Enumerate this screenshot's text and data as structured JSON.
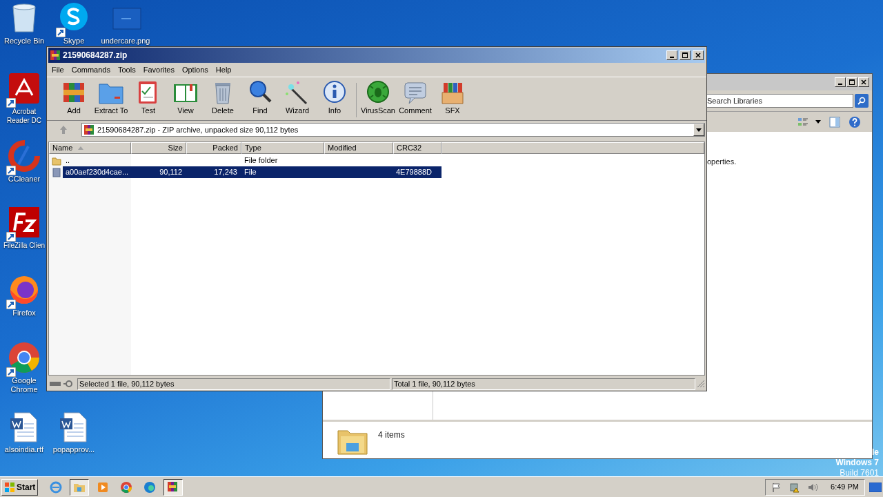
{
  "desktop_icons": [
    {
      "label": "Recycle Bin",
      "kind": "bin",
      "shortcut": false
    },
    {
      "label": "Skype",
      "kind": "skype",
      "shortcut": true
    },
    {
      "label": "undercare.png",
      "kind": "image",
      "shortcut": false
    },
    {
      "label": "Acrobat Reader DC",
      "kind": "acrobat",
      "shortcut": true
    },
    {
      "label": "CCleaner",
      "kind": "ccleaner",
      "shortcut": true
    },
    {
      "label": "FileZilla Clien",
      "kind": "filezilla",
      "shortcut": true
    },
    {
      "label": "Firefox",
      "kind": "firefox",
      "shortcut": true
    },
    {
      "label": "Google Chrome",
      "kind": "chrome",
      "shortcut": true
    },
    {
      "label": "alsoindia.rtf",
      "kind": "word",
      "shortcut": false
    },
    {
      "label": "popapprov...",
      "kind": "word",
      "shortcut": false
    }
  ],
  "explorer": {
    "search": {
      "placeholder": "Search Libraries"
    },
    "body_text": "operties.",
    "item_count": "4 items"
  },
  "winrar": {
    "title": "21590684287.zip",
    "menu": [
      "File",
      "Commands",
      "Tools",
      "Favorites",
      "Options",
      "Help"
    ],
    "toolbar": [
      {
        "label": "Add",
        "kind": "add"
      },
      {
        "label": "Extract To",
        "kind": "extract"
      },
      {
        "label": "Test",
        "kind": "test"
      },
      {
        "label": "View",
        "kind": "view"
      },
      {
        "label": "Delete",
        "kind": "delete"
      },
      {
        "label": "Find",
        "kind": "find"
      },
      {
        "label": "Wizard",
        "kind": "wizard"
      },
      {
        "label": "Info",
        "kind": "info"
      },
      {
        "label": "VirusScan",
        "kind": "virus"
      },
      {
        "label": "Comment",
        "kind": "comment"
      },
      {
        "label": "SFX",
        "kind": "sfx"
      }
    ],
    "address": "21590684287.zip - ZIP archive, unpacked size 90,112 bytes",
    "columns": [
      {
        "label": "Name",
        "sorted": true
      },
      {
        "label": "Size",
        "sorted": false
      },
      {
        "label": "Packed",
        "sorted": false
      },
      {
        "label": "Type",
        "sorted": false
      },
      {
        "label": "Modified",
        "sorted": false
      },
      {
        "label": "CRC32",
        "sorted": false
      }
    ],
    "rows": [
      {
        "kind": "folder",
        "name": "..",
        "size": "",
        "packed": "",
        "type": "File folder",
        "crc": "",
        "selected": false
      },
      {
        "kind": "file",
        "name": "a00aef230d4cae...",
        "size": "90,112",
        "packed": "17,243",
        "type": "File",
        "crc": "4E79888D",
        "selected": true
      }
    ],
    "status_left": "Selected 1 file, 90,112 bytes",
    "status_right": "Total 1 file, 90,112 bytes"
  },
  "windows_notice": [
    "le",
    "Windows 7",
    "Build 7601"
  ],
  "taskbar": {
    "start": "Start",
    "apps": [
      {
        "kind": "ie",
        "selected": false
      },
      {
        "kind": "explorer",
        "selected": true
      },
      {
        "kind": "media",
        "selected": false
      },
      {
        "kind": "chrome",
        "selected": false
      },
      {
        "kind": "edge",
        "selected": false
      },
      {
        "kind": "winrar",
        "selected": true
      }
    ],
    "clock": "6:49 PM"
  }
}
